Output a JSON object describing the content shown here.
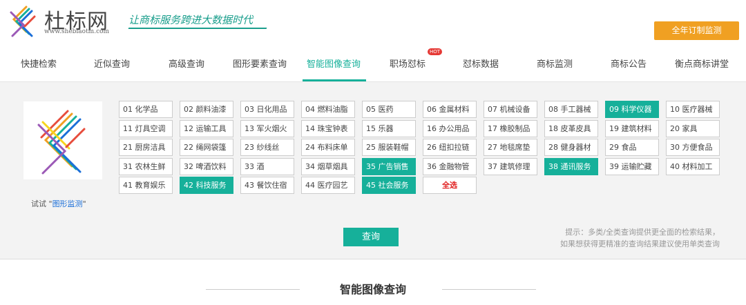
{
  "header": {
    "brand": "杜标网",
    "domain": "www.shebiaotm.com",
    "slogan": "让商标服务跨进大数据时代",
    "top_button": "全年订制监测"
  },
  "nav": {
    "items": [
      "快捷检索",
      "近似查询",
      "高级查询",
      "图形要素查询",
      "智能图像查询",
      "职场怼标",
      "怼标数据",
      "商标监测",
      "商标公告",
      "衡点商标讲堂"
    ],
    "active_index": 4,
    "hot_badge": "HOT"
  },
  "panel": {
    "try_prefix": "试试 \"",
    "try_link": "图形监测",
    "try_suffix": "\"",
    "categories": [
      "01 化学品",
      "02 颜料油漆",
      "03 日化用品",
      "04 燃料油脂",
      "05 医药",
      "06 金属材料",
      "07 机械设备",
      "08 手工器械",
      "09 科学仪器",
      "10 医疗器械",
      "11 灯具空调",
      "12 运输工具",
      "13 军火烟火",
      "14 珠宝钟表",
      "15 乐器",
      "16 办公用品",
      "17 橡胶制品",
      "18 皮革皮具",
      "19 建筑材料",
      "20 家具",
      "21 厨房洁具",
      "22 绳网袋篷",
      "23 纱线丝",
      "24 布料床单",
      "25 服装鞋帽",
      "26 纽扣拉链",
      "27 地毯席垫",
      "28 健身器材",
      "29 食品",
      "30 方便食品",
      "31 农林生鲜",
      "32 啤酒饮料",
      "33 酒",
      "34 烟草烟具",
      "35 广告销售",
      "36 金融物管",
      "37 建筑修理",
      "38 通讯服务",
      "39 运输贮藏",
      "40 材料加工",
      "41 教育娱乐",
      "42 科技服务",
      "43 餐饮住宿",
      "44 医疗园艺",
      "45 社会服务"
    ],
    "selected": [
      "09 科学仪器",
      "35 广告销售",
      "38 通讯服务",
      "42 科技服务",
      "45 社会服务"
    ],
    "select_all": "全选",
    "query_button": "查询",
    "hint_line1": "提示：多类/全类查询提供更全面的检索结果，",
    "hint_line2": "如果想获得更精准的查询结果建议使用单类查询"
  },
  "section": {
    "title": "智能图像查询"
  },
  "colors": {
    "accent": "#16b09a",
    "orange": "#f0a022",
    "link": "#1a6ed8",
    "select_all": "#e02020"
  }
}
